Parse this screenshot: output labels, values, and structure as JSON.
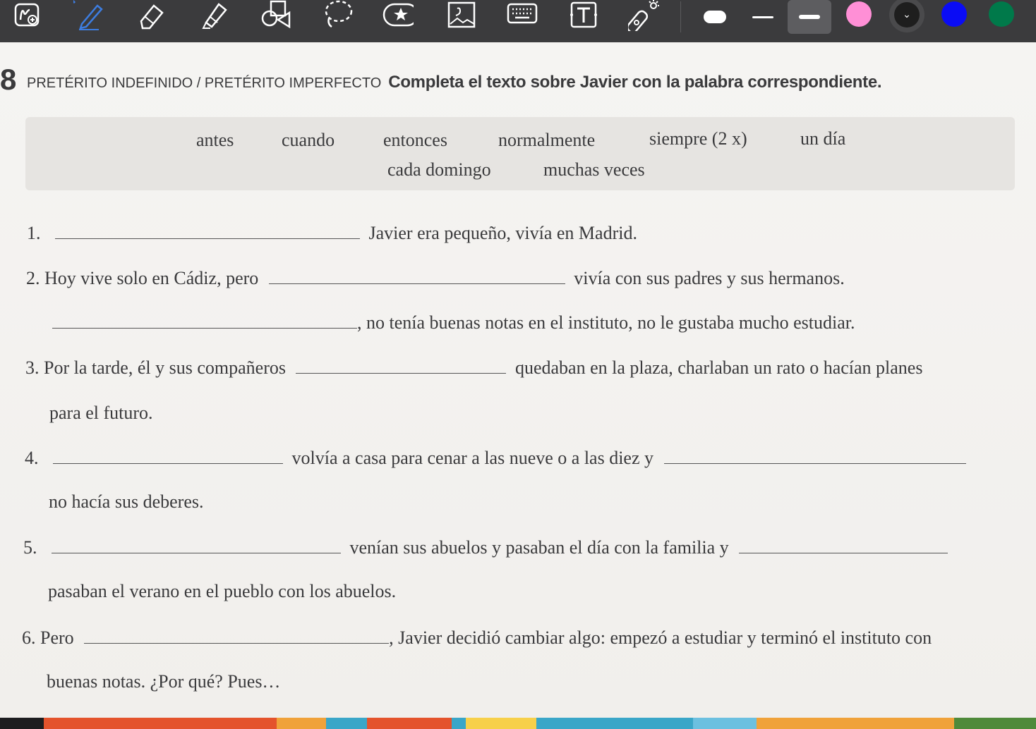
{
  "toolbar": {
    "tools": [
      {
        "name": "lasso-add-icon"
      },
      {
        "name": "pen-icon"
      },
      {
        "name": "eraser-icon"
      },
      {
        "name": "highlighter-icon"
      },
      {
        "name": "shapes-icon"
      },
      {
        "name": "lasso-icon"
      },
      {
        "name": "sticker-icon"
      },
      {
        "name": "image-icon"
      },
      {
        "name": "keyboard-icon"
      },
      {
        "name": "text-box-icon"
      },
      {
        "name": "laser-pointer-icon"
      }
    ],
    "colors": [
      "#ffffff",
      "#ff8fd6",
      "#1e1e1e",
      "#0a0cf5",
      "#00794a"
    ],
    "accent": "#3d7de0"
  },
  "exercise": {
    "number": "8",
    "kind": "Pretérito indefinido / pretérito imperfecto",
    "instruction": "Completa el texto sobre Javier con la palabra correspondiente.",
    "words_row1": [
      "antes",
      "cuando",
      "entonces",
      "normalmente",
      "siempre (2 x)",
      "un día"
    ],
    "words_row2": [
      "cada domingo",
      "muchas veces"
    ],
    "lines": {
      "l1_num": "1.",
      "l1_after": "Javier era pequeño, vivía en Madrid.",
      "l2_num": "2.",
      "l2_before": "Hoy vive solo en Cádiz, pero",
      "l2_after": "vivía con sus padres y sus hermanos.",
      "l2b_after": ", no tenía buenas notas en el instituto, no le gustaba mucho estudiar.",
      "l3_num": "3.",
      "l3_before": "Por la tarde, él y sus compañeros",
      "l3_after": "quedaban en la plaza, charlaban un rato o hacían planes",
      "l3b": "para el futuro.",
      "l4_num": "4.",
      "l4_after": "volvía a casa para cenar a las nueve o a las diez y",
      "l4b": "no hacía sus deberes.",
      "l5_num": "5.",
      "l5_after": "venían sus abuelos y pasaban el día con la familia y",
      "l5b": "pasaban el verano en el pueblo con los abuelos.",
      "l6_num": "6.",
      "l6_before": "Pero",
      "l6_after": ", Javier decidió cambiar algo: empezó a estudiar y terminó el instituto con",
      "l6b": "buenas notas. ¿Por qué? Pues…"
    }
  }
}
